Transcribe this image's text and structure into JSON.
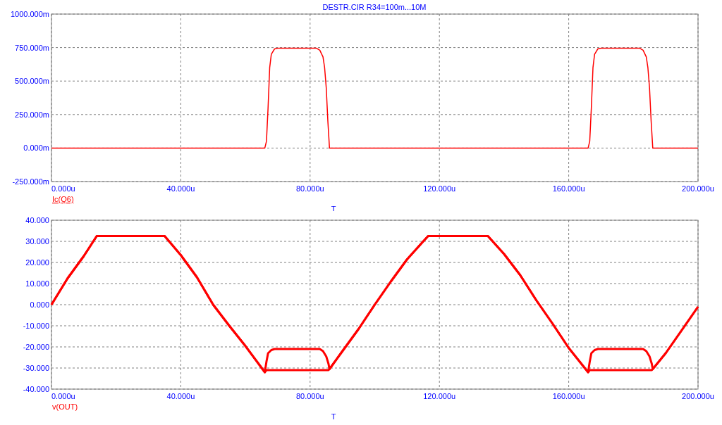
{
  "title": "DESTR.CIR R34=100m...10M",
  "plots": [
    {
      "legend": {
        "text": "Ic(Q6)",
        "selected": true
      },
      "chart_data": {
        "type": "line",
        "xlabel": "T",
        "x": [
          0,
          66,
          66.5,
          67,
          67.5,
          68,
          69,
          70,
          82,
          83,
          84,
          84.5,
          85,
          85.5,
          86,
          166,
          166.5,
          167,
          167.5,
          168,
          169,
          170,
          182,
          183,
          184,
          184.5,
          185,
          185.5,
          186,
          200
        ],
        "series": [
          {
            "color": "#ff0000",
            "values": [
              0,
              0,
              50,
              300,
              600,
              700,
              740,
              745,
              745,
              730,
              680,
              600,
              450,
              200,
              0,
              0,
              50,
              300,
              600,
              700,
              740,
              745,
              745,
              730,
              680,
              600,
              450,
              200,
              0,
              0
            ]
          }
        ],
        "xlim": [
          0,
          200
        ],
        "ylim": [
          -250,
          1000
        ],
        "grid": true,
        "xticks": [
          {
            "value": 0,
            "label": "0.000u"
          },
          {
            "value": 40,
            "label": "40.000u"
          },
          {
            "value": 80,
            "label": "80.000u"
          },
          {
            "value": 120,
            "label": "120.000u"
          },
          {
            "value": 160,
            "label": "160.000u"
          },
          {
            "value": 200,
            "label": "200.000u"
          }
        ],
        "yticks": [
          {
            "value": 1000,
            "label": "1000.000m"
          },
          {
            "value": 750,
            "label": "750.000m"
          },
          {
            "value": 500,
            "label": "500.000m"
          },
          {
            "value": 250,
            "label": "250.000m"
          },
          {
            "value": 0,
            "label": "0.000m"
          },
          {
            "value": -250,
            "label": "-250.000m"
          }
        ]
      }
    },
    {
      "legend": {
        "text": "v(OUT)",
        "selected": false
      },
      "chart_data": {
        "type": "line",
        "xlabel": "T",
        "x": [
          0,
          5,
          10,
          14,
          35,
          40,
          45,
          50,
          55,
          60,
          66,
          66.5,
          67,
          68,
          69,
          83,
          84,
          85,
          85.7,
          86,
          90,
          95,
          100,
          105,
          110,
          115,
          116.5,
          135,
          140,
          145,
          150,
          155,
          160,
          166,
          166.5,
          167,
          168,
          169,
          183,
          184,
          185,
          185.7,
          186,
          190,
          195,
          200
        ],
        "series": [
          {
            "color": "#ff0000",
            "values": [
              0,
              12.5,
              23,
              32.5,
              32.5,
              23.5,
              13,
              0,
              -10,
              -19.6,
              -32,
              -31,
              -31,
              -31,
              -31,
              -31,
              -31,
              -31,
              -31,
              -30.5,
              -22,
              -11.5,
              0,
              11,
              21.5,
              30,
              32.5,
              32.5,
              24,
              14,
              2,
              -9,
              -20.5,
              -32,
              -31,
              -31,
              -31,
              -31,
              -31,
              -31,
              -31,
              -31,
              -30.5,
              -23,
              -12,
              -1
            ]
          },
          {
            "color": "#ff0000",
            "values": [
              0,
              12.5,
              23,
              32.5,
              32.5,
              23.5,
              13,
              0,
              -10,
              -19.6,
              -32,
              -27,
              -23,
              -21.5,
              -21,
              -21,
              -22,
              -24.5,
              -28,
              -30.5,
              -22,
              -11.5,
              0,
              11,
              21.5,
              30,
              32.5,
              32.5,
              24,
              14,
              2,
              -9,
              -20.5,
              -32,
              -27,
              -23,
              -21.5,
              -21,
              -21,
              -22,
              -24.5,
              -28,
              -30.5,
              -23,
              -12,
              -1
            ]
          }
        ],
        "xlim": [
          0,
          200
        ],
        "ylim": [
          -40,
          40
        ],
        "grid": true,
        "xticks": [
          {
            "value": 0,
            "label": "0.000u"
          },
          {
            "value": 40,
            "label": "40.000u"
          },
          {
            "value": 80,
            "label": "80.000u"
          },
          {
            "value": 120,
            "label": "120.000u"
          },
          {
            "value": 160,
            "label": "160.000u"
          },
          {
            "value": 200,
            "label": "200.000u"
          }
        ],
        "yticks": [
          {
            "value": 40,
            "label": "40.000"
          },
          {
            "value": 30,
            "label": "30.000"
          },
          {
            "value": 20,
            "label": "20.000"
          },
          {
            "value": 10,
            "label": "10.000"
          },
          {
            "value": 0,
            "label": "0.000"
          },
          {
            "value": -10,
            "label": "-10.000"
          },
          {
            "value": -20,
            "label": "-20.000"
          },
          {
            "value": -30,
            "label": "-30.000"
          },
          {
            "value": -40,
            "label": "-40.000"
          }
        ]
      }
    }
  ]
}
